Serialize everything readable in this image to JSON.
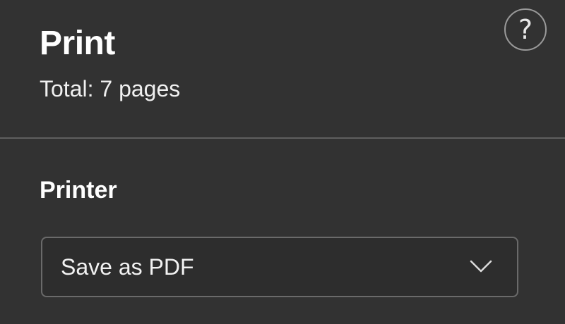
{
  "header": {
    "title": "Print",
    "subtitle": "Total: 7 pages",
    "help_icon": "question-mark-circle-icon"
  },
  "printer": {
    "label": "Printer",
    "selected": "Save as PDF",
    "dropdown_icon": "chevron-down-icon"
  },
  "colors": {
    "background": "#323232",
    "divider": "#5f5f5f",
    "select_border": "#6a6a6a",
    "text": "#f2f2f2"
  }
}
